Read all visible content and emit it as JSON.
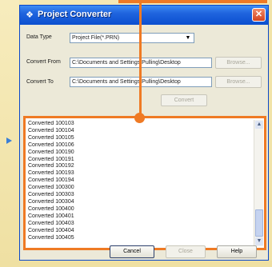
{
  "window": {
    "title": "Project Converter",
    "close_glyph": "✕",
    "title_icon": "project-converter-icon"
  },
  "form": {
    "data_type_label": "Data Type",
    "data_type_value": "Project File(*.PRN)",
    "convert_from_label": "Convert From",
    "convert_from_value": "C:\\Documents and Settings\\Pulling\\Desktop",
    "convert_to_label": "Convert To",
    "convert_to_value": "C:\\Documents and Settings\\Pulling\\Desktop",
    "browse_from_label": "Browse...",
    "browse_to_label": "Browse...",
    "convert_label": "Convert"
  },
  "log": {
    "lines": [
      "Converted 100103",
      "Converted 100104",
      "Converted 100105",
      "Converted 100106",
      "Converted 100190",
      "Converted 100191",
      "Converted 100192",
      "Converted 100193",
      "Converted 100194",
      "Converted 100300",
      "Converted 100303",
      "Converted 100304",
      "Converted 100400",
      "Converted 100401",
      "Converted 100403",
      "Converted 100404",
      "Converted 100405"
    ]
  },
  "footer": {
    "cancel_label": "Cancel",
    "close_label": "Close",
    "help_label": "Help"
  },
  "colors": {
    "callout": "#ef7a24",
    "titlebar": "#1f64de",
    "background": "#f4e8b4"
  }
}
